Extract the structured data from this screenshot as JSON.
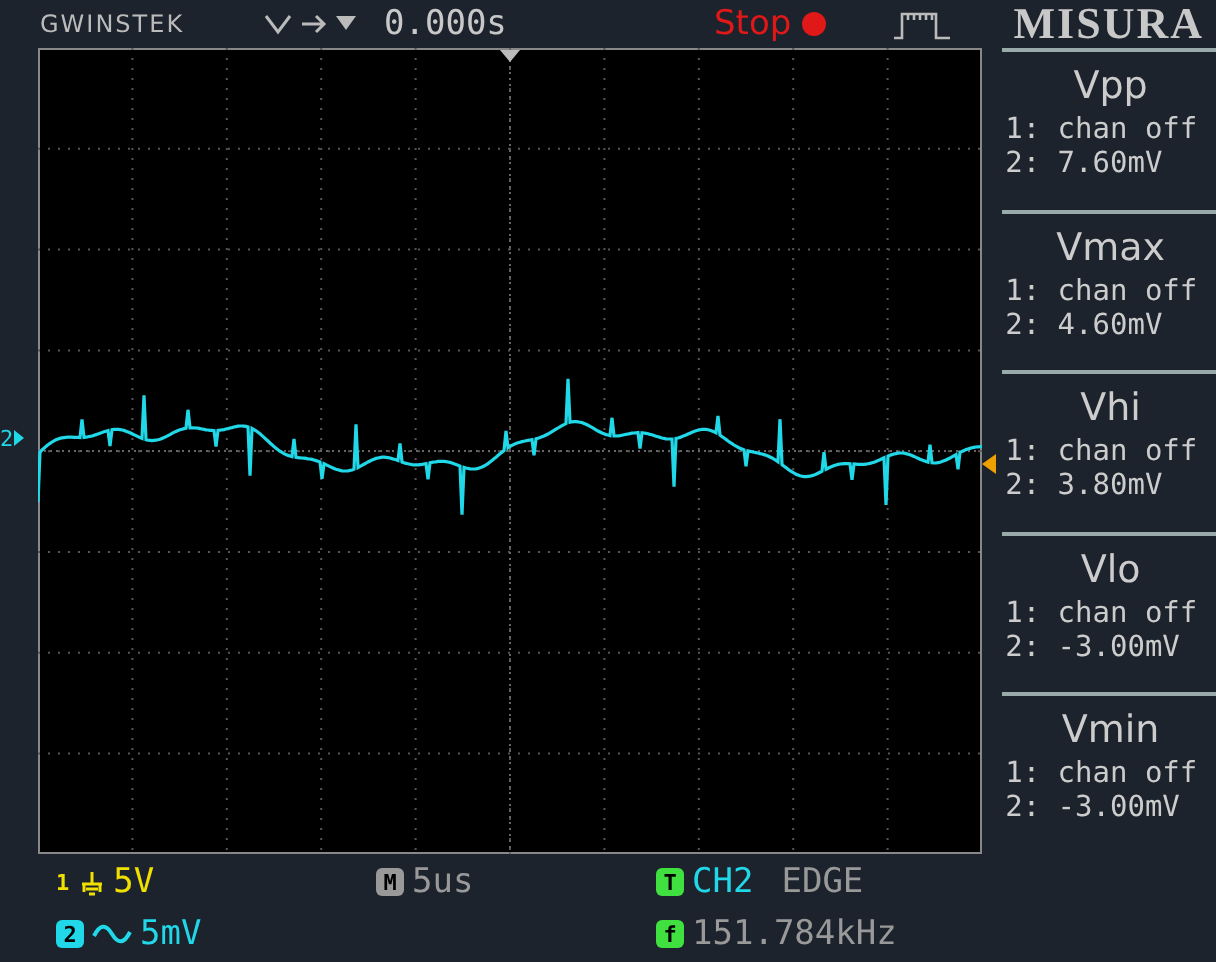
{
  "header": {
    "brand": "GWINSTEK",
    "time": "0.000s",
    "status": "Stop",
    "title": "MISURA"
  },
  "screen": {
    "channel_marker": "2"
  },
  "measurements": [
    {
      "name": "Vpp",
      "lines": [
        "1: chan off",
        "2: 7.60mV"
      ]
    },
    {
      "name": "Vmax",
      "lines": [
        "1: chan off",
        "2: 4.60mV"
      ]
    },
    {
      "name": "Vhi",
      "lines": [
        "1: chan off",
        "2: 3.80mV"
      ]
    },
    {
      "name": "Vlo",
      "lines": [
        "1: chan off",
        "2: -3.00mV"
      ]
    },
    {
      "name": "Vmin",
      "lines": [
        "1: chan off",
        "2: -3.00mV"
      ]
    }
  ],
  "channels": [
    {
      "number": "1",
      "kind": "gnd",
      "scale": "5V",
      "color": "#f0e000"
    },
    {
      "number": "2",
      "kind": "ac",
      "scale": "5mV",
      "color": "#20d8e8"
    }
  ],
  "timebase": {
    "label": "M",
    "value": "5us"
  },
  "trigger": {
    "label": "T",
    "source": "CH2",
    "type": "EDGE"
  },
  "frequency": {
    "label": "f",
    "value": "151.784kHz"
  }
}
